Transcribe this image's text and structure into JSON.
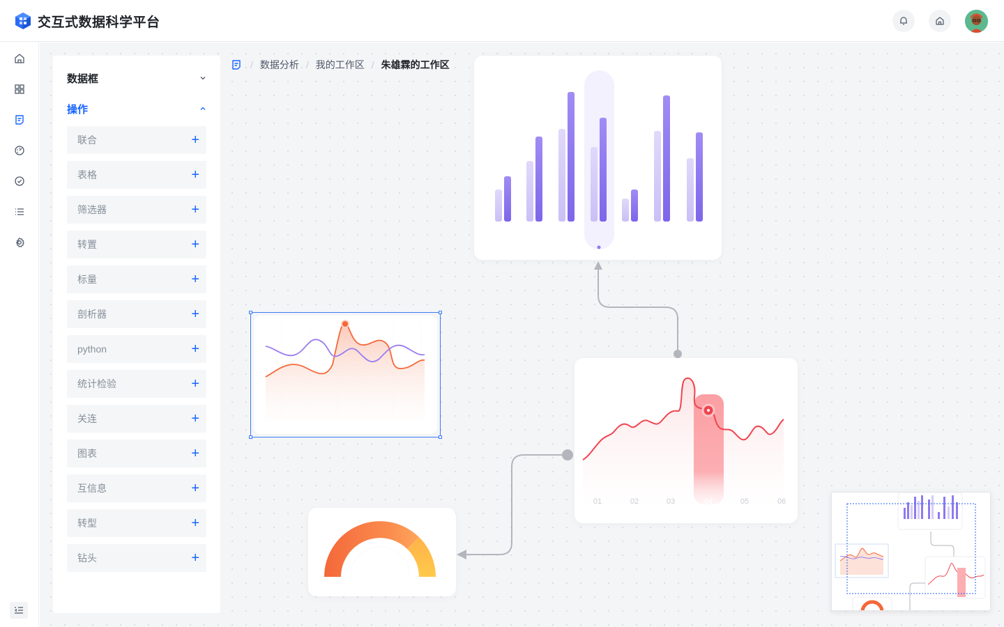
{
  "app": {
    "title": "交互式数据科学平台"
  },
  "header": {
    "icons": [
      "bell-icon",
      "home-icon",
      "avatar"
    ]
  },
  "rail": {
    "icons": [
      "home-icon",
      "grid-icon",
      "document-icon",
      "dashboard-icon",
      "check-circle-icon",
      "list-icon",
      "settings-icon",
      "collapse-menu-icon"
    ]
  },
  "panel": {
    "sections": [
      {
        "label": "数据框",
        "expanded": false
      },
      {
        "label": "操作",
        "expanded": true
      }
    ],
    "operations": [
      "联合",
      "表格",
      "筛选器",
      "转置",
      "标量",
      "剖析器",
      "python",
      "统计检验",
      "关连",
      "图表",
      "互信息",
      "转型",
      "钻头"
    ]
  },
  "breadcrumb": {
    "items": [
      "数据分析",
      "我的工作区"
    ],
    "current": "朱雄霖的工作区"
  },
  "colors": {
    "accent": "#1664ff",
    "bar_dark": "#8f79ef",
    "bar_light": "#d4ccf8",
    "line_red": "#f0454f",
    "line_orange": "#f4683a",
    "line_purple": "#9a7cf0",
    "gauge_start": "#f4683a",
    "gauge_end": "#ffc24a"
  },
  "line_card": {
    "ticks": [
      "01",
      "02",
      "03",
      "04",
      "05",
      "06"
    ],
    "highlight": "04"
  }
}
